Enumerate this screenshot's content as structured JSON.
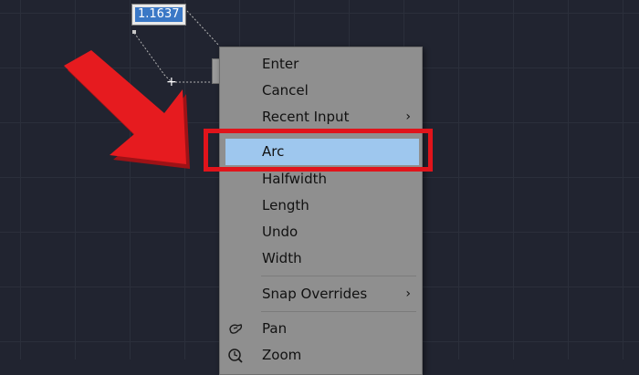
{
  "dynamic_input": {
    "value": "1.1637"
  },
  "context_menu": {
    "items": [
      {
        "label": "Enter"
      },
      {
        "label": "Cancel"
      },
      {
        "label": "Recent Input",
        "submenu_glyph": "›"
      },
      {
        "label": "Arc",
        "highlighted": true
      },
      {
        "label": "Halfwidth"
      },
      {
        "label": "Length"
      },
      {
        "label": "Undo"
      },
      {
        "label": "Width"
      },
      {
        "label": "Snap Overrides",
        "submenu_glyph": "›"
      },
      {
        "label": "Pan",
        "icon": "pan-hand-icon"
      },
      {
        "label": "Zoom",
        "icon": "zoom-realtime-icon"
      }
    ]
  },
  "annotation": {
    "arrow_color": "#e61b1f",
    "box_color": "#e0141b"
  },
  "colors": {
    "canvas": "#212430",
    "menu_bg": "#8f8f8f",
    "highlight": "#9ec7ee",
    "input_selection": "#3a78c6"
  }
}
